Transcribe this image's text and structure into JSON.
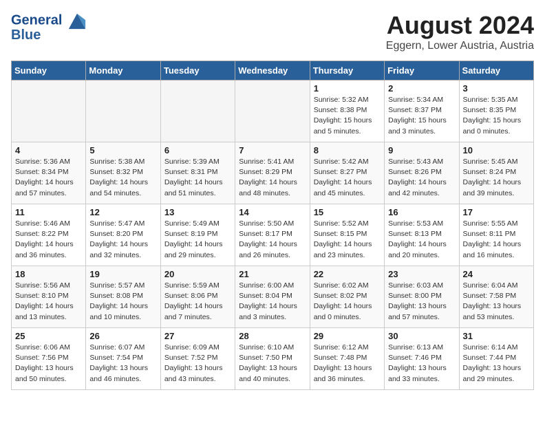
{
  "header": {
    "logo_line1": "General",
    "logo_line2": "Blue",
    "month_year": "August 2024",
    "location": "Eggern, Lower Austria, Austria"
  },
  "weekdays": [
    "Sunday",
    "Monday",
    "Tuesday",
    "Wednesday",
    "Thursday",
    "Friday",
    "Saturday"
  ],
  "weeks": [
    [
      {
        "day": "",
        "empty": true
      },
      {
        "day": "",
        "empty": true
      },
      {
        "day": "",
        "empty": true
      },
      {
        "day": "",
        "empty": true
      },
      {
        "day": "1",
        "sunrise": "5:32 AM",
        "sunset": "8:38 PM",
        "daylight": "15 hours and 5 minutes."
      },
      {
        "day": "2",
        "sunrise": "5:34 AM",
        "sunset": "8:37 PM",
        "daylight": "15 hours and 3 minutes."
      },
      {
        "day": "3",
        "sunrise": "5:35 AM",
        "sunset": "8:35 PM",
        "daylight": "15 hours and 0 minutes."
      }
    ],
    [
      {
        "day": "4",
        "sunrise": "5:36 AM",
        "sunset": "8:34 PM",
        "daylight": "14 hours and 57 minutes."
      },
      {
        "day": "5",
        "sunrise": "5:38 AM",
        "sunset": "8:32 PM",
        "daylight": "14 hours and 54 minutes."
      },
      {
        "day": "6",
        "sunrise": "5:39 AM",
        "sunset": "8:31 PM",
        "daylight": "14 hours and 51 minutes."
      },
      {
        "day": "7",
        "sunrise": "5:41 AM",
        "sunset": "8:29 PM",
        "daylight": "14 hours and 48 minutes."
      },
      {
        "day": "8",
        "sunrise": "5:42 AM",
        "sunset": "8:27 PM",
        "daylight": "14 hours and 45 minutes."
      },
      {
        "day": "9",
        "sunrise": "5:43 AM",
        "sunset": "8:26 PM",
        "daylight": "14 hours and 42 minutes."
      },
      {
        "day": "10",
        "sunrise": "5:45 AM",
        "sunset": "8:24 PM",
        "daylight": "14 hours and 39 minutes."
      }
    ],
    [
      {
        "day": "11",
        "sunrise": "5:46 AM",
        "sunset": "8:22 PM",
        "daylight": "14 hours and 36 minutes."
      },
      {
        "day": "12",
        "sunrise": "5:47 AM",
        "sunset": "8:20 PM",
        "daylight": "14 hours and 32 minutes."
      },
      {
        "day": "13",
        "sunrise": "5:49 AM",
        "sunset": "8:19 PM",
        "daylight": "14 hours and 29 minutes."
      },
      {
        "day": "14",
        "sunrise": "5:50 AM",
        "sunset": "8:17 PM",
        "daylight": "14 hours and 26 minutes."
      },
      {
        "day": "15",
        "sunrise": "5:52 AM",
        "sunset": "8:15 PM",
        "daylight": "14 hours and 23 minutes."
      },
      {
        "day": "16",
        "sunrise": "5:53 AM",
        "sunset": "8:13 PM",
        "daylight": "14 hours and 20 minutes."
      },
      {
        "day": "17",
        "sunrise": "5:55 AM",
        "sunset": "8:11 PM",
        "daylight": "14 hours and 16 minutes."
      }
    ],
    [
      {
        "day": "18",
        "sunrise": "5:56 AM",
        "sunset": "8:10 PM",
        "daylight": "14 hours and 13 minutes."
      },
      {
        "day": "19",
        "sunrise": "5:57 AM",
        "sunset": "8:08 PM",
        "daylight": "14 hours and 10 minutes."
      },
      {
        "day": "20",
        "sunrise": "5:59 AM",
        "sunset": "8:06 PM",
        "daylight": "14 hours and 7 minutes."
      },
      {
        "day": "21",
        "sunrise": "6:00 AM",
        "sunset": "8:04 PM",
        "daylight": "14 hours and 3 minutes."
      },
      {
        "day": "22",
        "sunrise": "6:02 AM",
        "sunset": "8:02 PM",
        "daylight": "14 hours and 0 minutes."
      },
      {
        "day": "23",
        "sunrise": "6:03 AM",
        "sunset": "8:00 PM",
        "daylight": "13 hours and 57 minutes."
      },
      {
        "day": "24",
        "sunrise": "6:04 AM",
        "sunset": "7:58 PM",
        "daylight": "13 hours and 53 minutes."
      }
    ],
    [
      {
        "day": "25",
        "sunrise": "6:06 AM",
        "sunset": "7:56 PM",
        "daylight": "13 hours and 50 minutes."
      },
      {
        "day": "26",
        "sunrise": "6:07 AM",
        "sunset": "7:54 PM",
        "daylight": "13 hours and 46 minutes."
      },
      {
        "day": "27",
        "sunrise": "6:09 AM",
        "sunset": "7:52 PM",
        "daylight": "13 hours and 43 minutes."
      },
      {
        "day": "28",
        "sunrise": "6:10 AM",
        "sunset": "7:50 PM",
        "daylight": "13 hours and 40 minutes."
      },
      {
        "day": "29",
        "sunrise": "6:12 AM",
        "sunset": "7:48 PM",
        "daylight": "13 hours and 36 minutes."
      },
      {
        "day": "30",
        "sunrise": "6:13 AM",
        "sunset": "7:46 PM",
        "daylight": "13 hours and 33 minutes."
      },
      {
        "day": "31",
        "sunrise": "6:14 AM",
        "sunset": "7:44 PM",
        "daylight": "13 hours and 29 minutes."
      }
    ]
  ],
  "labels": {
    "sunrise": "Sunrise:",
    "sunset": "Sunset:",
    "daylight": "Daylight:"
  }
}
